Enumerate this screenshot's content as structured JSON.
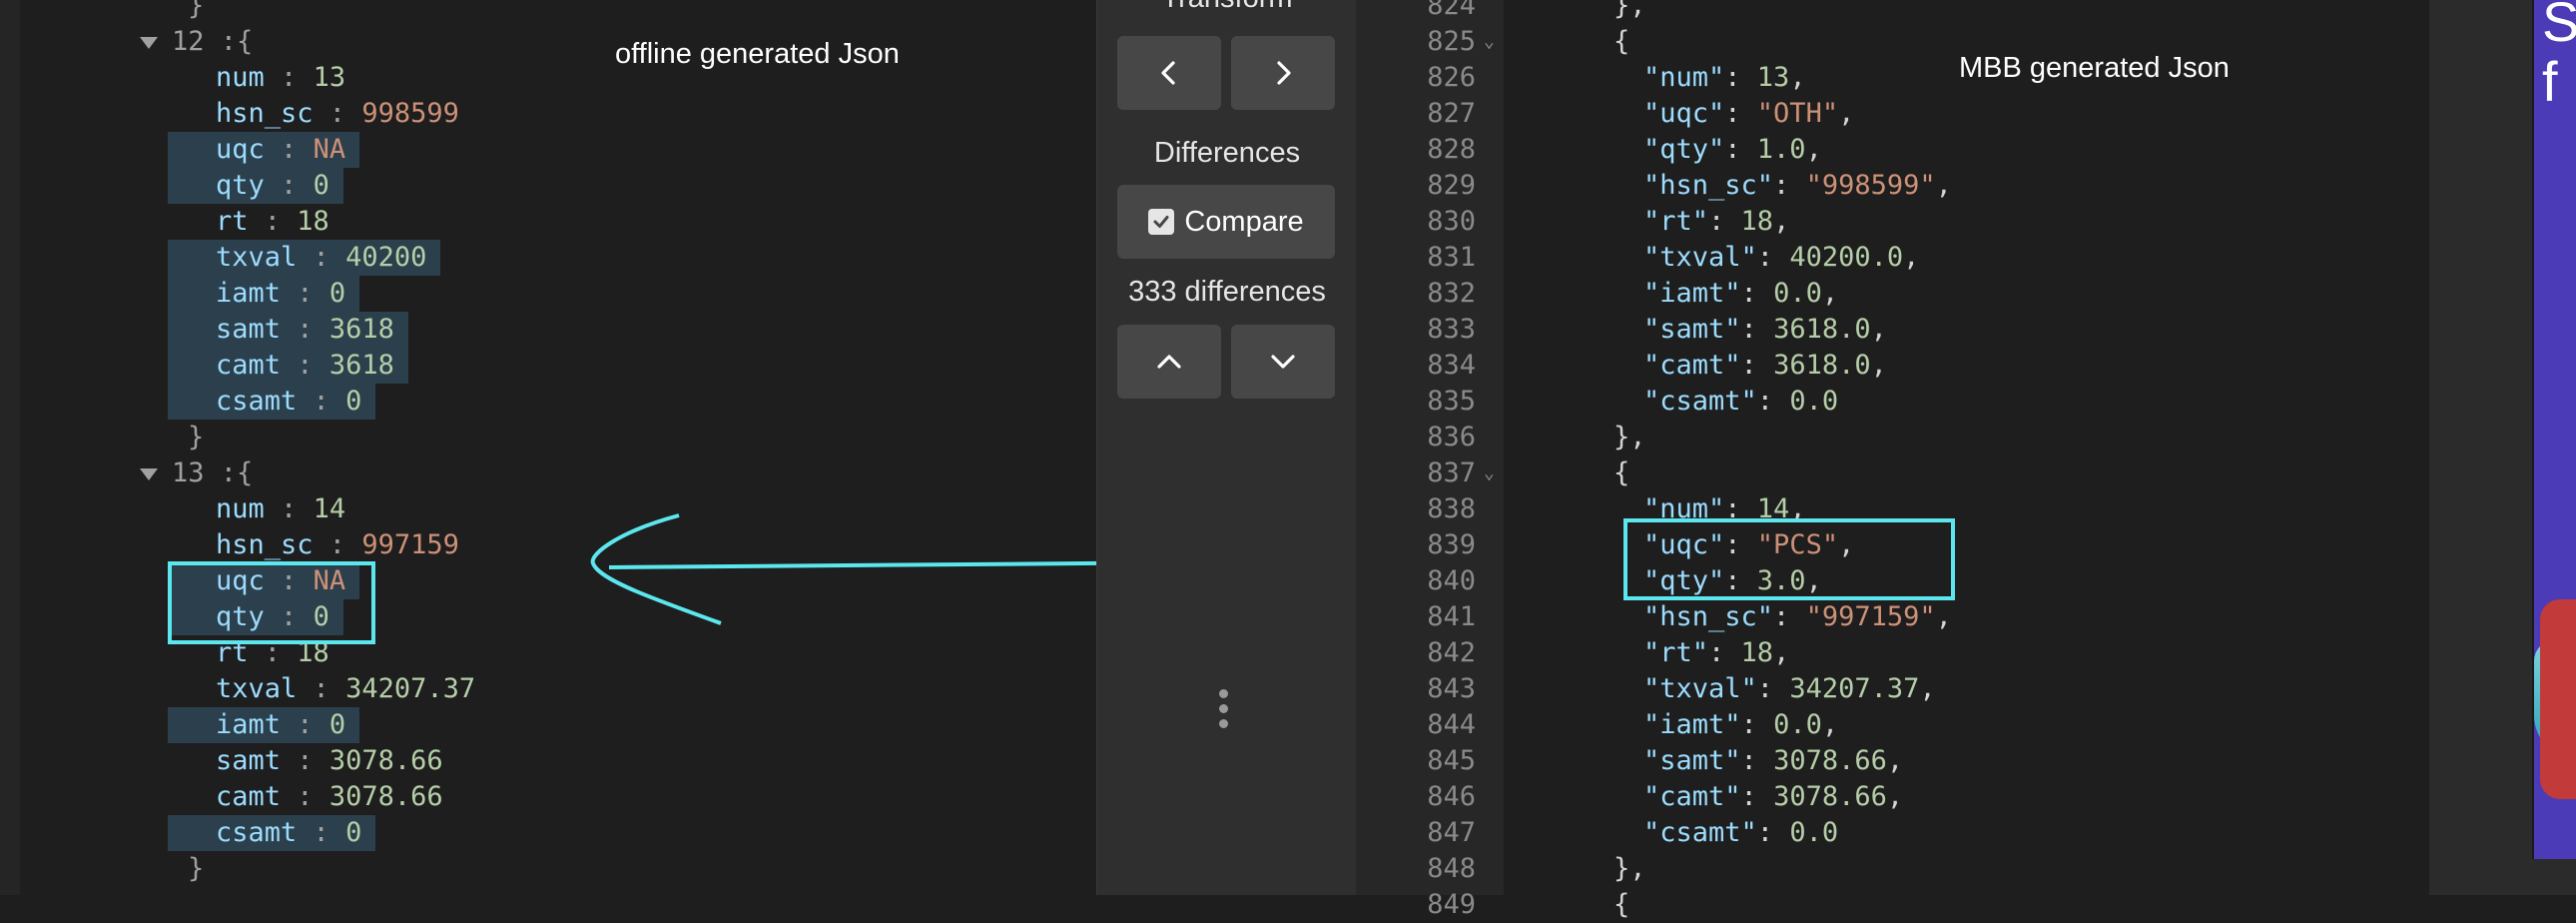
{
  "left": {
    "annotation": "offline generated Json",
    "top_brace": "}",
    "obj12_index": "12",
    "obj13_index": "13",
    "colon": ":",
    "open_brace": "{",
    "close_brace": "}",
    "obj12": [
      {
        "key": "num",
        "value": "13",
        "type": "num",
        "hl": false
      },
      {
        "key": "hsn_sc",
        "value": "998599",
        "type": "str",
        "hl": false
      },
      {
        "key": "uqc",
        "value": "NA",
        "type": "str",
        "hl": true
      },
      {
        "key": "qty",
        "value": "0",
        "type": "num",
        "hl": true
      },
      {
        "key": "rt",
        "value": "18",
        "type": "num",
        "hl": false
      },
      {
        "key": "txval",
        "value": "40200",
        "type": "num",
        "hl": true
      },
      {
        "key": "iamt",
        "value": "0",
        "type": "num",
        "hl": true
      },
      {
        "key": "samt",
        "value": "3618",
        "type": "num",
        "hl": true
      },
      {
        "key": "camt",
        "value": "3618",
        "type": "num",
        "hl": true
      },
      {
        "key": "csamt",
        "value": "0",
        "type": "num",
        "hl": true
      }
    ],
    "obj13": [
      {
        "key": "num",
        "value": "14",
        "type": "num",
        "hl": false
      },
      {
        "key": "hsn_sc",
        "value": "997159",
        "type": "str",
        "hl": false
      },
      {
        "key": "uqc",
        "value": "NA",
        "type": "str",
        "hl": true
      },
      {
        "key": "qty",
        "value": "0",
        "type": "num",
        "hl": true
      },
      {
        "key": "rt",
        "value": "18",
        "type": "num",
        "hl": false
      },
      {
        "key": "txval",
        "value": "34207.37",
        "type": "num",
        "hl": false
      },
      {
        "key": "iamt",
        "value": "0",
        "type": "num",
        "hl": true
      },
      {
        "key": "samt",
        "value": "3078.66",
        "type": "num",
        "hl": false
      },
      {
        "key": "camt",
        "value": "3078.66",
        "type": "num",
        "hl": false
      },
      {
        "key": "csamt",
        "value": "0",
        "type": "num",
        "hl": true
      }
    ]
  },
  "middle": {
    "transform_label": "Transform",
    "differences_label": "Differences",
    "compare_label": "Compare",
    "diff_count_label": "333 differences",
    "prev_icon": "chevron-left-icon",
    "next_icon": "chevron-right-icon",
    "up_icon": "chevron-up-icon",
    "down_icon": "chevron-down-icon",
    "menu_icon": "vertical-dots-icon"
  },
  "right": {
    "annotation": "MBB generated Json",
    "line_numbers": [
      "824",
      "825",
      "826",
      "827",
      "828",
      "829",
      "830",
      "831",
      "832",
      "833",
      "834",
      "835",
      "836",
      "837",
      "838",
      "839",
      "840",
      "841",
      "842",
      "843",
      "844",
      "845",
      "846",
      "847",
      "848",
      "849"
    ],
    "fold_lines": [
      "825",
      "837"
    ],
    "lines": [
      {
        "kind": "punct",
        "text": "},"
      },
      {
        "kind": "punct",
        "text": "{"
      },
      {
        "kind": "pair",
        "key": "\"num\"",
        "sep": ": ",
        "value": "13",
        "vtype": "n",
        "tail": ","
      },
      {
        "kind": "pair",
        "key": "\"uqc\"",
        "sep": ": ",
        "value": "\"OTH\"",
        "vtype": "s",
        "tail": ","
      },
      {
        "kind": "pair",
        "key": "\"qty\"",
        "sep": ": ",
        "value": "1.0",
        "vtype": "n",
        "tail": ","
      },
      {
        "kind": "pair",
        "key": "\"hsn_sc\"",
        "sep": ": ",
        "value": "\"998599\"",
        "vtype": "s",
        "tail": ","
      },
      {
        "kind": "pair",
        "key": "\"rt\"",
        "sep": ": ",
        "value": "18",
        "vtype": "n",
        "tail": ","
      },
      {
        "kind": "pair",
        "key": "\"txval\"",
        "sep": ": ",
        "value": "40200.0",
        "vtype": "n",
        "tail": ","
      },
      {
        "kind": "pair",
        "key": "\"iamt\"",
        "sep": ": ",
        "value": "0.0",
        "vtype": "n",
        "tail": ","
      },
      {
        "kind": "pair",
        "key": "\"samt\"",
        "sep": ": ",
        "value": "3618.0",
        "vtype": "n",
        "tail": ","
      },
      {
        "kind": "pair",
        "key": "\"camt\"",
        "sep": ": ",
        "value": "3618.0",
        "vtype": "n",
        "tail": ","
      },
      {
        "kind": "pair",
        "key": "\"csamt\"",
        "sep": ": ",
        "value": "0.0",
        "vtype": "n",
        "tail": ""
      },
      {
        "kind": "punct",
        "text": "},"
      },
      {
        "kind": "punct",
        "text": "{"
      },
      {
        "kind": "pair",
        "key": "\"num\"",
        "sep": ": ",
        "value": "14",
        "vtype": "n",
        "tail": ","
      },
      {
        "kind": "pair",
        "key": "\"uqc\"",
        "sep": ": ",
        "value": "\"PCS\"",
        "vtype": "s",
        "tail": ","
      },
      {
        "kind": "pair",
        "key": "\"qty\"",
        "sep": ": ",
        "value": "3.0",
        "vtype": "n",
        "tail": ","
      },
      {
        "kind": "pair",
        "key": "\"hsn_sc\"",
        "sep": ": ",
        "value": "\"997159\"",
        "vtype": "s",
        "tail": ","
      },
      {
        "kind": "pair",
        "key": "\"rt\"",
        "sep": ": ",
        "value": "18",
        "vtype": "n",
        "tail": ","
      },
      {
        "kind": "pair",
        "key": "\"txval\"",
        "sep": ": ",
        "value": "34207.37",
        "vtype": "n",
        "tail": ","
      },
      {
        "kind": "pair",
        "key": "\"iamt\"",
        "sep": ": ",
        "value": "0.0",
        "vtype": "n",
        "tail": ","
      },
      {
        "kind": "pair",
        "key": "\"samt\"",
        "sep": ": ",
        "value": "3078.66",
        "vtype": "n",
        "tail": ","
      },
      {
        "kind": "pair",
        "key": "\"camt\"",
        "sep": ": ",
        "value": "3078.66",
        "vtype": "n",
        "tail": ","
      },
      {
        "kind": "pair",
        "key": "\"csamt\"",
        "sep": ": ",
        "value": "0.0",
        "vtype": "n",
        "tail": ""
      },
      {
        "kind": "punct",
        "text": "},"
      },
      {
        "kind": "punct",
        "text": "{"
      }
    ]
  },
  "far_right": {
    "thumb_text": "S\nf"
  },
  "colors": {
    "highlight_box": "#5ce7ee",
    "key": "#9cdcfe",
    "string": "#ce9178",
    "number": "#b5cea8",
    "diff_bg": "#2c3f4c"
  }
}
